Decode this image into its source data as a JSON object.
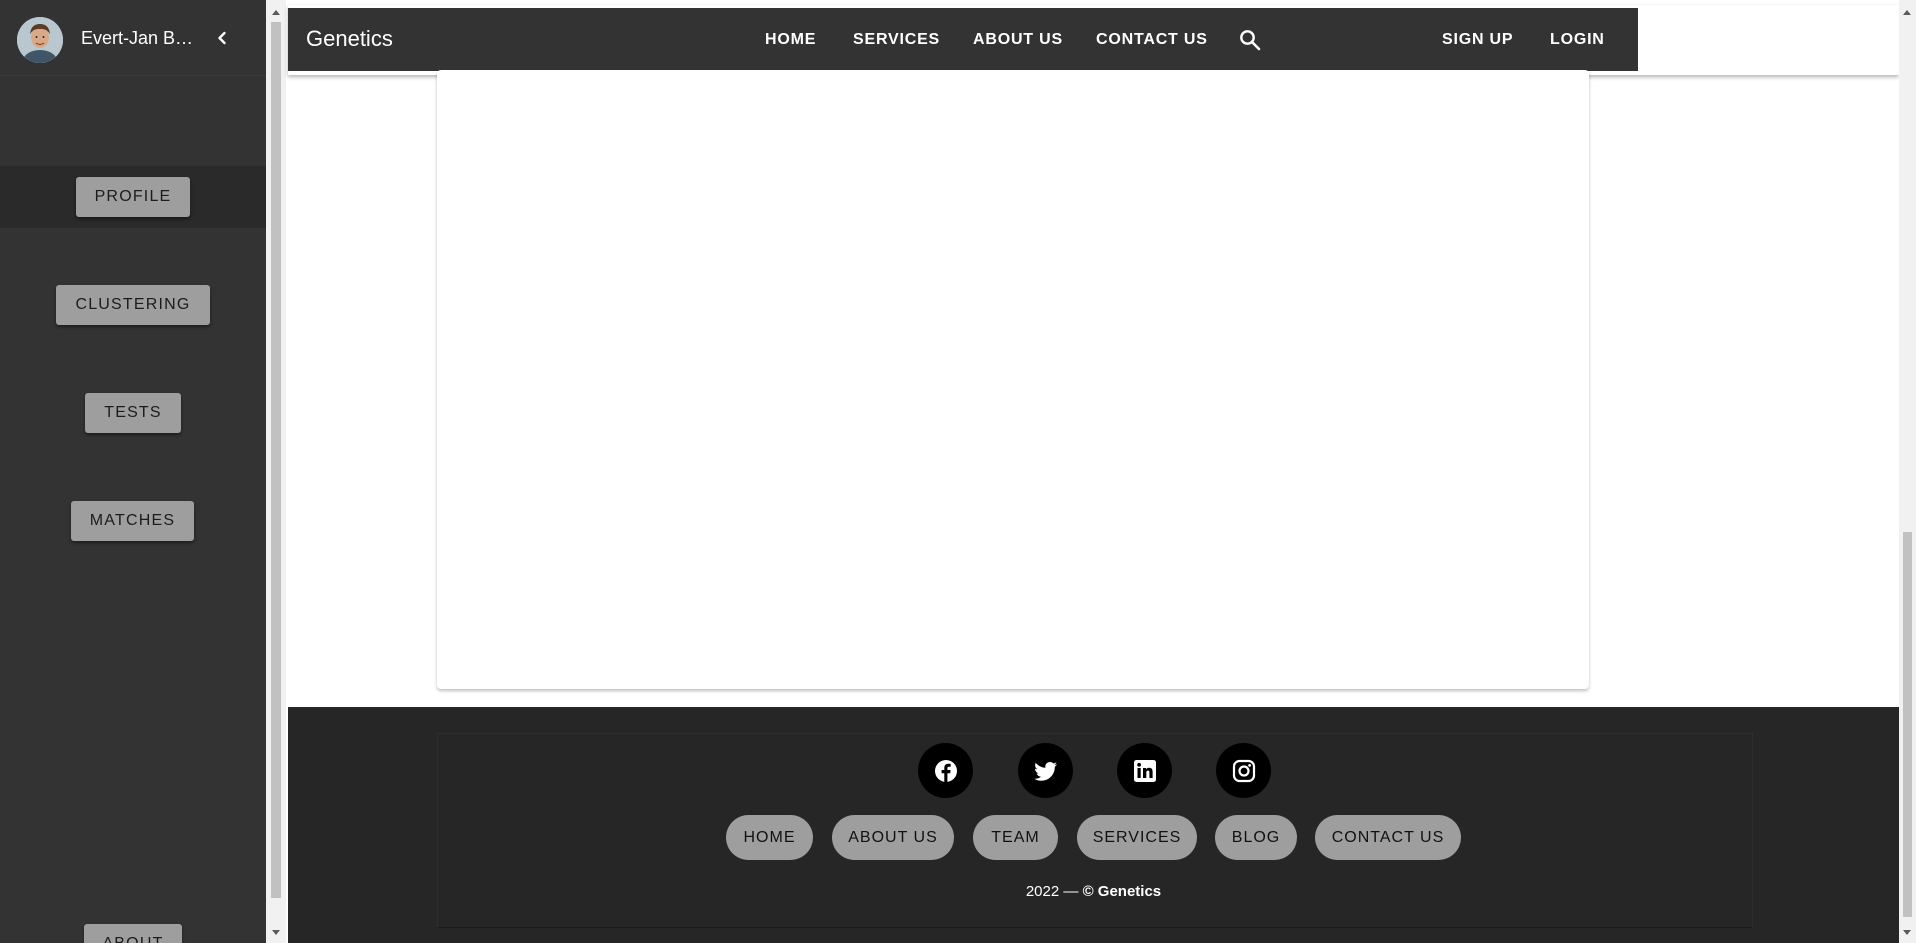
{
  "app": {
    "brand": "Genetics"
  },
  "sidebar": {
    "username": "Evert-Jan Bakker",
    "collapse_icon": "chevron-left-icon",
    "avatar_icon": "user-avatar-icon",
    "items": [
      {
        "label": "PROFILE",
        "active": true
      },
      {
        "label": "CLUSTERING"
      },
      {
        "label": "TESTS"
      },
      {
        "label": "MATCHES"
      },
      {
        "label": "ABOUT"
      }
    ]
  },
  "navbar": {
    "links": [
      "HOME",
      "SERVICES",
      "ABOUT US",
      "CONTACT US"
    ],
    "search_icon": "search-icon",
    "auth": {
      "signup": "SIGN UP",
      "login": "LOGIN"
    }
  },
  "footer": {
    "social": [
      "facebook-icon",
      "twitter-icon",
      "linkedin-icon",
      "instagram-icon"
    ],
    "links": [
      "HOME",
      "ABOUT US",
      "TEAM",
      "SERVICES",
      "BLOG",
      "CONTACT US"
    ],
    "copyright_year": "2022 — ",
    "copyright_owner": "© Genetics"
  },
  "colors": {
    "sidebar_bg": "#333333",
    "navbar_bg": "#333333",
    "footer_bg": "#262626",
    "button_bg": "#9e9e9e",
    "accent_text": "#ffffff"
  }
}
